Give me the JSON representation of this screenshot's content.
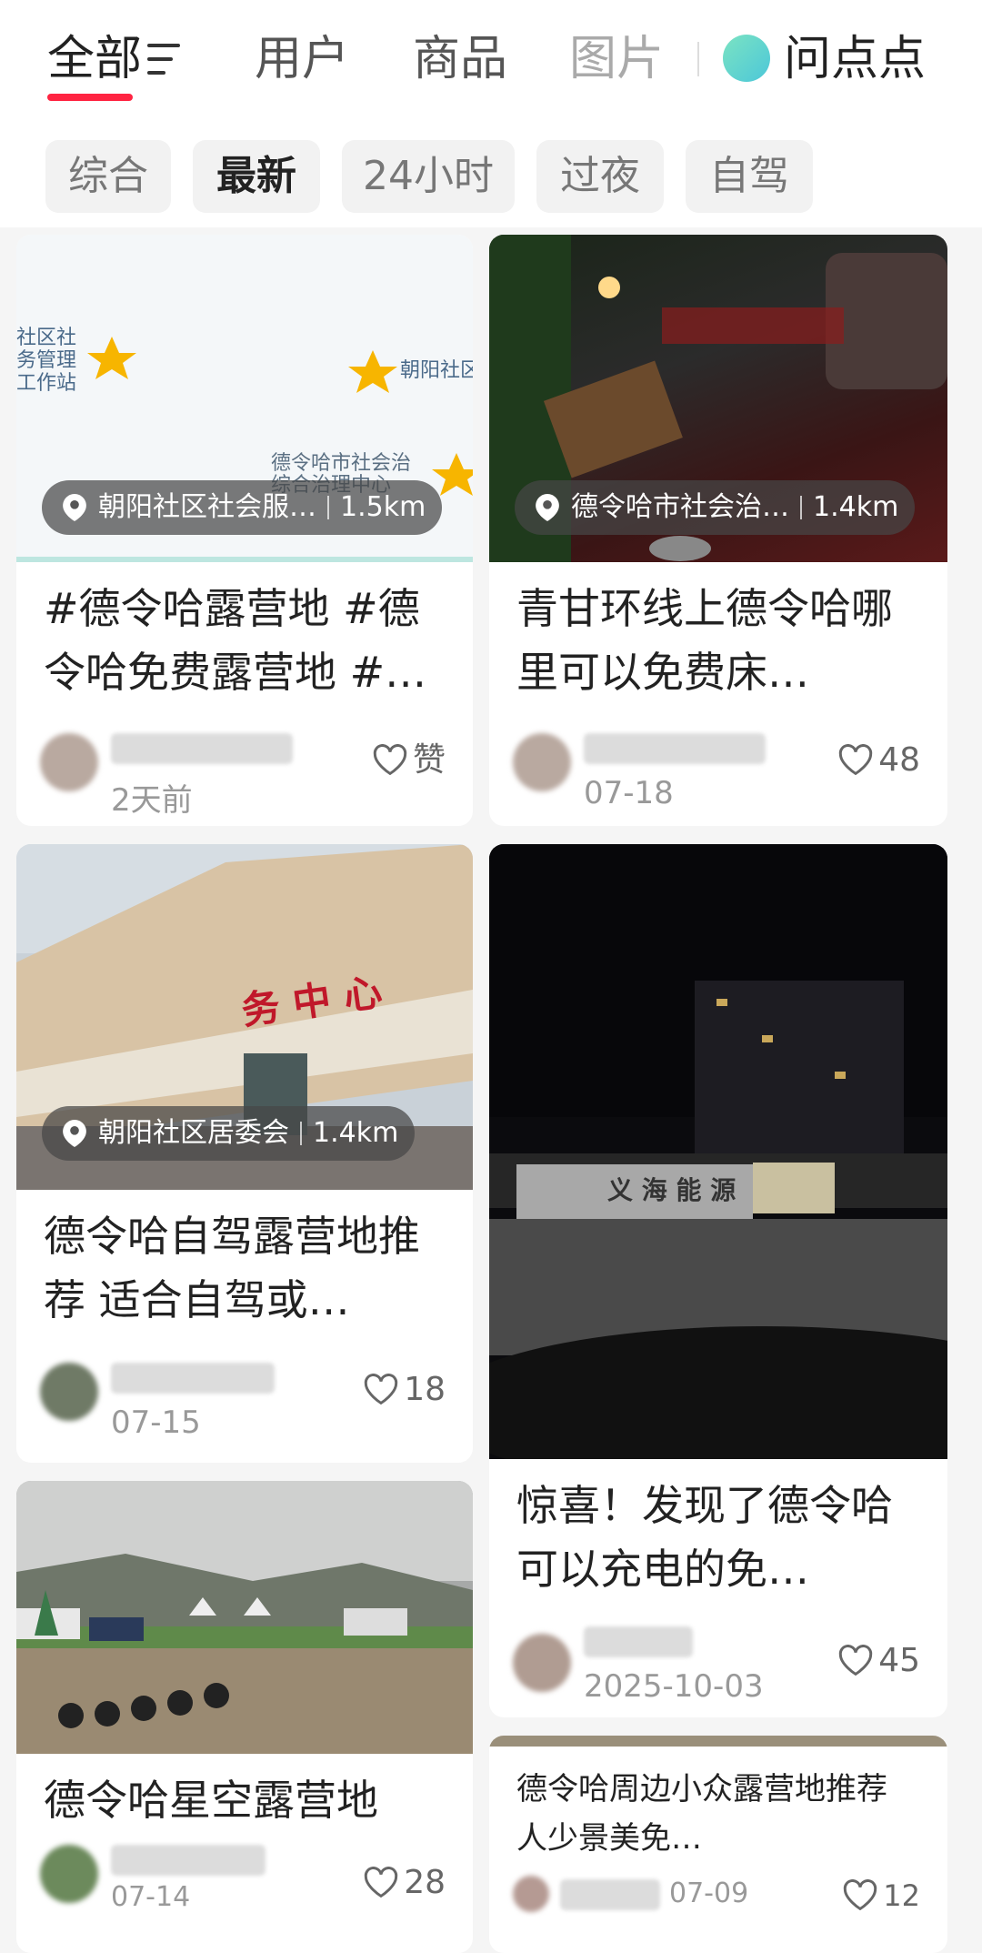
{
  "tabs": [
    {
      "label": "全部"
    },
    {
      "label": "用户"
    },
    {
      "label": "商品"
    },
    {
      "label": "图片"
    }
  ],
  "ai_tab": {
    "label": "问点点"
  },
  "filters": [
    {
      "label": "综合"
    },
    {
      "label": "最新"
    },
    {
      "label": "24小时"
    },
    {
      "label": "过夜"
    },
    {
      "label": "自驾"
    }
  ],
  "cards": [
    {
      "title": "#德令哈露营地 #德令哈免费露营地 #…",
      "location": "朝阳社区社会服…",
      "distance": "1.5km",
      "image_text": [
        "社区社务管理工作站",
        "朝阳社区",
        "德令哈市社会治综合治理中心"
      ],
      "date": "2天前",
      "likes": "赞"
    },
    {
      "title": "青甘环线上德令哈哪里可以免费床…",
      "location": "德令哈市社会治…",
      "distance": "1.4km",
      "date": "07-18",
      "likes": "48"
    },
    {
      "title": "德令哈自驾露营地推荐 适合自驾或…",
      "location": "朝阳社区居委会",
      "distance": "1.4km",
      "image_text": "务 中 心",
      "date": "07-15",
      "likes": "18"
    },
    {
      "title": "惊喜！发现了德令哈可以充电的免…",
      "image_text": "义 海 能 源",
      "date": "2025-10-03",
      "likes": "45"
    },
    {
      "title": "德令哈星空露营地",
      "date": "07-14",
      "likes": "28"
    },
    {
      "title": "德令哈周边小众露营地推荐 人少景美免…",
      "date": "07-09",
      "likes": "12"
    }
  ],
  "colors": {
    "accent": "#ff2442",
    "star": "#f7b500"
  }
}
